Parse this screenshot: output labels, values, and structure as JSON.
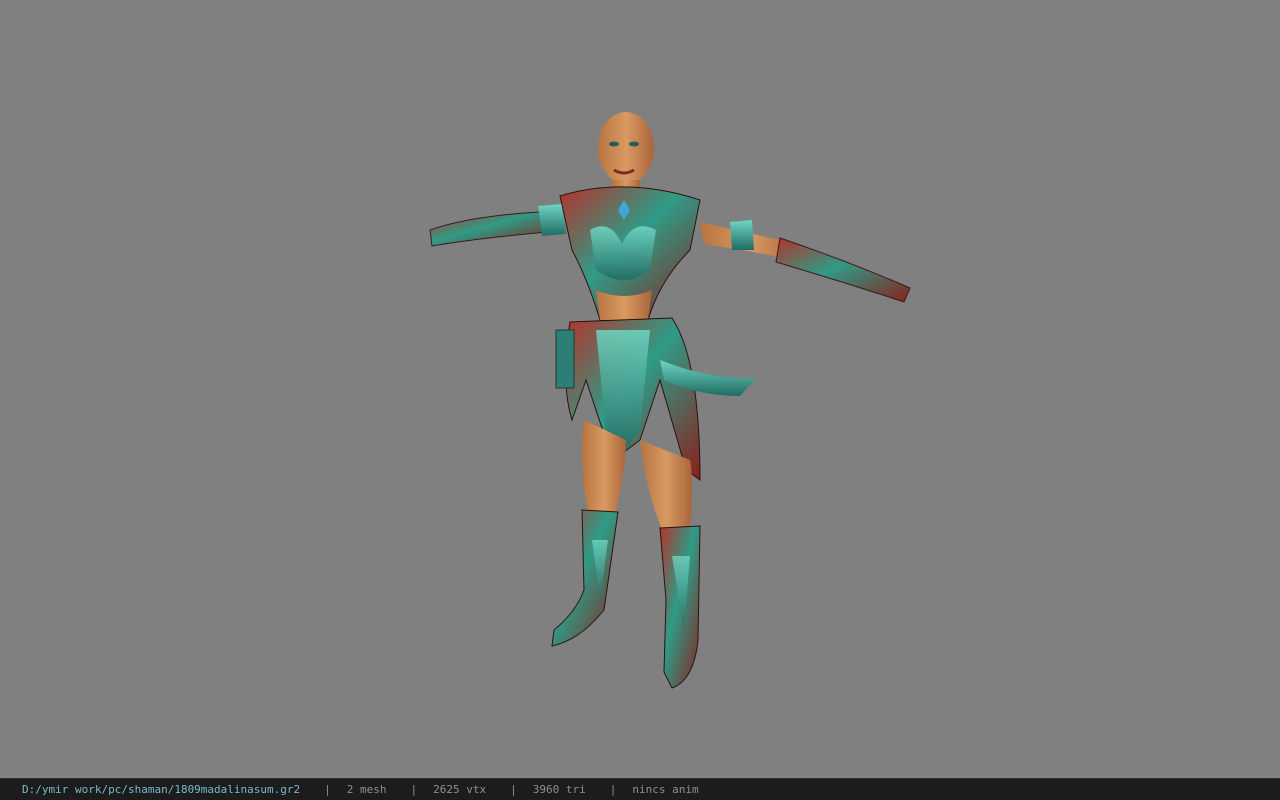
{
  "viewport": {
    "background": "#808080"
  },
  "status": {
    "path": "D:/ymir work/pc/shaman/1809madalinasum.gr2",
    "separator": "|",
    "mesh": "2 mesh",
    "vertices": "2625 vtx",
    "triangles": "3960 tri",
    "animation": "nincs anim",
    "colors": {
      "path": "#79b8c9",
      "text": "#8f8f8f",
      "background": "#1c1c1c"
    }
  }
}
